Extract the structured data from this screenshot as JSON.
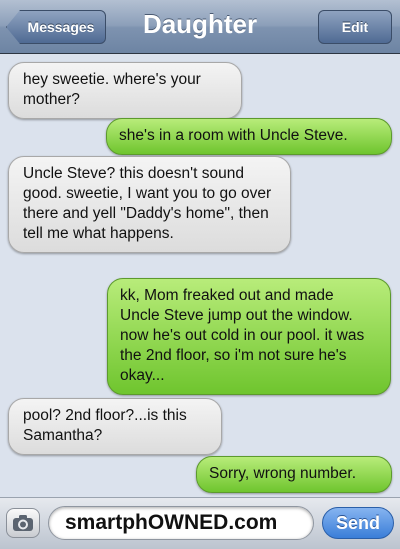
{
  "nav": {
    "title": "Daughter",
    "back_label": "Messages",
    "edit_label": "Edit"
  },
  "messages": [
    {
      "direction": "incoming",
      "text": "hey sweetie. where's your mother?"
    },
    {
      "direction": "outgoing",
      "text": "she's in a room with Uncle Steve."
    },
    {
      "direction": "incoming",
      "text": "Uncle Steve? this doesn't sound good. sweetie, I want you to go over there and yell \"Daddy's home\", then tell me what happens."
    },
    {
      "direction": "outgoing",
      "text": "kk, Mom freaked out and made Uncle Steve jump out the window. now he's out cold in our pool. it was the 2nd floor, so i'm not sure he's okay..."
    },
    {
      "direction": "incoming",
      "text": "pool? 2nd floor?...is this Samantha?"
    },
    {
      "direction": "outgoing",
      "text": "Sorry, wrong number."
    }
  ],
  "input_bar": {
    "camera_icon": "camera-icon",
    "text_value": "smartphOWNED.com",
    "send_label": "Send"
  },
  "colors": {
    "incoming_bubble": "#e6e6e6",
    "outgoing_bubble": "#8fd84c",
    "navbar": "#7e93b0",
    "background": "#dbe2ed",
    "send_button": "#3a7ed8"
  }
}
